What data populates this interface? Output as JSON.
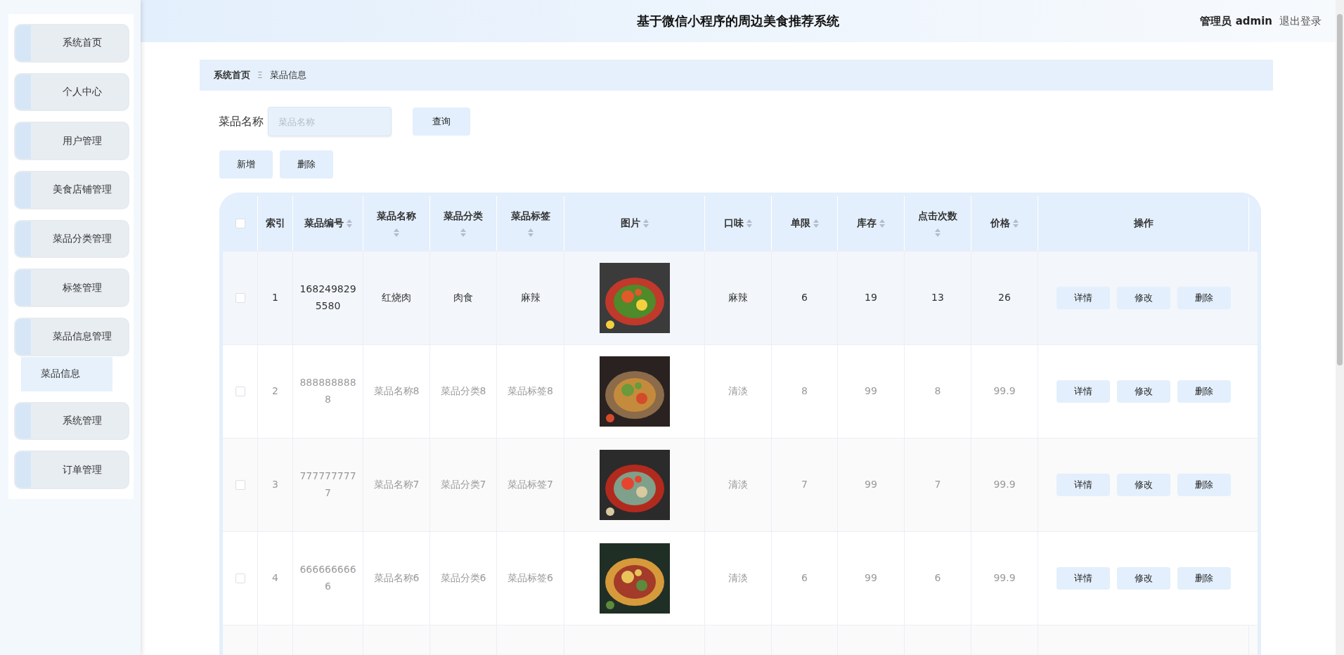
{
  "sidebar": {
    "items": [
      {
        "label": "系统首页",
        "selected": false
      },
      {
        "label": "个人中心",
        "selected": false
      },
      {
        "label": "用户管理",
        "selected": false
      },
      {
        "label": "美食店铺管理",
        "selected": false
      },
      {
        "label": "菜品分类管理",
        "selected": false
      },
      {
        "label": "标签管理",
        "selected": false
      },
      {
        "label": "菜品信息管理",
        "selected": false,
        "children": [
          {
            "label": "菜品信息",
            "selected": true
          }
        ]
      },
      {
        "label": "系统管理",
        "selected": false
      },
      {
        "label": "订单管理",
        "selected": false
      }
    ]
  },
  "header": {
    "title": "基于微信小程序的周边美食推荐系统",
    "user": "管理员 admin",
    "logout": "退出登录"
  },
  "breadcrumb": [
    {
      "label": "系统首页",
      "current": false
    },
    {
      "label": "菜品信息",
      "current": true
    }
  ],
  "breadcrumb_separator": "Ξ",
  "search": {
    "label": "菜品名称",
    "placeholder": "菜品名称",
    "button": "查询"
  },
  "actions": [
    "新增",
    "删除"
  ],
  "table": {
    "columns": [
      {
        "kind": "checkbox",
        "checked": false
      },
      {
        "kind": "text",
        "label": "索引",
        "sortable": false
      },
      {
        "kind": "text",
        "label": "菜品编号",
        "sortable": true
      },
      {
        "kind": "text",
        "label": "菜品名称",
        "sortable": true
      },
      {
        "kind": "text",
        "label": "菜品分类",
        "sortable": true
      },
      {
        "kind": "text",
        "label": "菜品标签",
        "sortable": true
      },
      {
        "kind": "text",
        "label": "图片",
        "sortable": true
      },
      {
        "kind": "text",
        "label": "口味",
        "sortable": true
      },
      {
        "kind": "text",
        "label": "单限",
        "sortable": true
      },
      {
        "kind": "text",
        "label": "库存",
        "sortable": true
      },
      {
        "kind": "text",
        "label": "点击次数",
        "sortable": true
      },
      {
        "kind": "text",
        "label": "价格",
        "sortable": true
      },
      {
        "kind": "text",
        "label": "操作",
        "sortable": false
      }
    ],
    "rows": [
      {
        "highlighted": true,
        "cells": [
          {
            "kind": "checkbox",
            "checked": false
          },
          {
            "kind": "text",
            "text": "1"
          },
          {
            "kind": "text",
            "text": "1682498295580"
          },
          {
            "kind": "text",
            "text": "红烧肉"
          },
          {
            "kind": "text",
            "text": "肉食"
          },
          {
            "kind": "text",
            "text": "麻辣"
          },
          {
            "kind": "picture"
          },
          {
            "kind": "text",
            "text": "麻辣"
          },
          {
            "kind": "text",
            "text": "6"
          },
          {
            "kind": "text",
            "text": "19"
          },
          {
            "kind": "text",
            "text": "13"
          },
          {
            "kind": "text",
            "text": "26"
          },
          {
            "kind": "buttons",
            "buttons": [
              "详情",
              "修改",
              "删除"
            ]
          }
        ]
      },
      {
        "highlighted": false,
        "cells": [
          {
            "kind": "checkbox",
            "checked": false
          },
          {
            "kind": "text",
            "text": "2"
          },
          {
            "kind": "text",
            "text": "8888888888"
          },
          {
            "kind": "text",
            "text": "菜品名称8"
          },
          {
            "kind": "text",
            "text": "菜品分类8"
          },
          {
            "kind": "text",
            "text": "菜品标签8"
          },
          {
            "kind": "picture"
          },
          {
            "kind": "text",
            "text": "清淡"
          },
          {
            "kind": "text",
            "text": "8"
          },
          {
            "kind": "text",
            "text": "99"
          },
          {
            "kind": "text",
            "text": "8"
          },
          {
            "kind": "text",
            "text": "99.9"
          },
          {
            "kind": "buttons",
            "buttons": [
              "详情",
              "修改",
              "删除"
            ]
          }
        ]
      },
      {
        "highlighted": false,
        "cells": [
          {
            "kind": "checkbox",
            "checked": false
          },
          {
            "kind": "text",
            "text": "3"
          },
          {
            "kind": "text",
            "text": "7777777777"
          },
          {
            "kind": "text",
            "text": "菜品名称7"
          },
          {
            "kind": "text",
            "text": "菜品分类7"
          },
          {
            "kind": "text",
            "text": "菜品标签7"
          },
          {
            "kind": "picture"
          },
          {
            "kind": "text",
            "text": "清淡"
          },
          {
            "kind": "text",
            "text": "7"
          },
          {
            "kind": "text",
            "text": "99"
          },
          {
            "kind": "text",
            "text": "7"
          },
          {
            "kind": "text",
            "text": "99.9"
          },
          {
            "kind": "buttons",
            "buttons": [
              "详情",
              "修改",
              "删除"
            ]
          }
        ]
      },
      {
        "highlighted": false,
        "cells": [
          {
            "kind": "checkbox",
            "checked": false
          },
          {
            "kind": "text",
            "text": "4"
          },
          {
            "kind": "text",
            "text": "6666666666"
          },
          {
            "kind": "text",
            "text": "菜品名称6"
          },
          {
            "kind": "text",
            "text": "菜品分类6"
          },
          {
            "kind": "text",
            "text": "菜品标签6"
          },
          {
            "kind": "picture"
          },
          {
            "kind": "text",
            "text": "清淡"
          },
          {
            "kind": "text",
            "text": "6"
          },
          {
            "kind": "text",
            "text": "99"
          },
          {
            "kind": "text",
            "text": "6"
          },
          {
            "kind": "text",
            "text": "99.9"
          },
          {
            "kind": "buttons",
            "buttons": [
              "详情",
              "修改",
              "删除"
            ]
          }
        ]
      }
    ]
  }
}
